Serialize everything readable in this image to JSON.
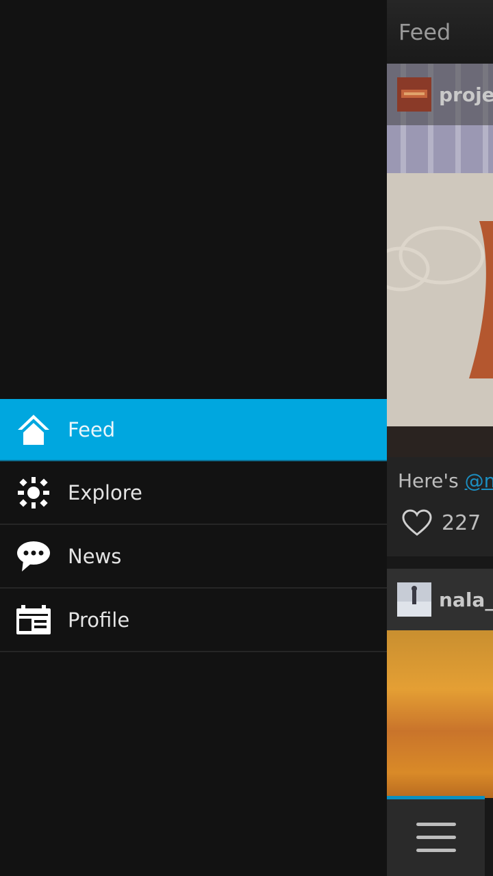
{
  "drawer": {
    "items": [
      {
        "label": "Feed",
        "icon": "home-icon",
        "active": true
      },
      {
        "label": "Explore",
        "icon": "explore-icon",
        "active": false
      },
      {
        "label": "News",
        "icon": "chat-bubble-icon",
        "active": false
      },
      {
        "label": "Profile",
        "icon": "profile-card-icon",
        "active": false
      }
    ]
  },
  "feed": {
    "title": "Feed",
    "posts": [
      {
        "user": "projec",
        "caption_prefix": "Here's ",
        "caption_mention": "@m",
        "likes": "227"
      },
      {
        "user": "nala_"
      }
    ]
  },
  "colors": {
    "accent": "#00a7df",
    "background": "#121212",
    "link": "#1c8fc2"
  }
}
